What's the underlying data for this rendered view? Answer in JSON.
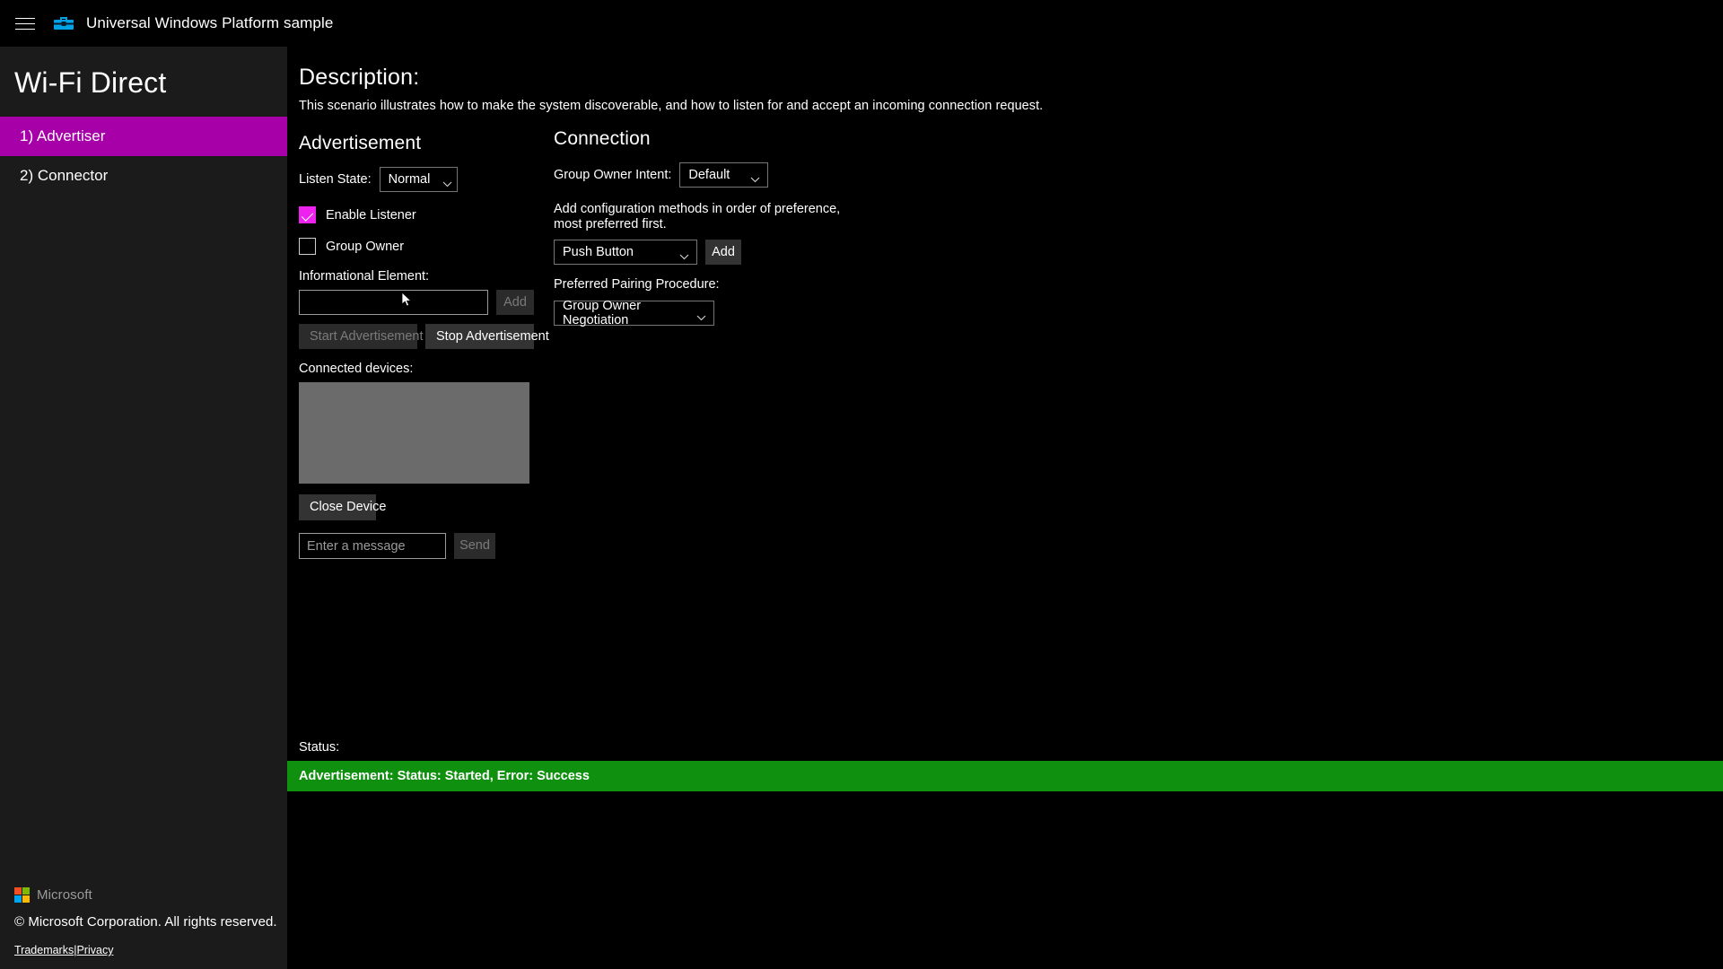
{
  "titlebar": {
    "menu_icon": "hamburger-menu-icon",
    "app_icon": "toolbox-app-icon",
    "title": "Universal Windows Platform sample"
  },
  "sidebar": {
    "header": "Wi-Fi Direct",
    "items": [
      {
        "label": "1) Advertiser",
        "selected": true
      },
      {
        "label": "2) Connector",
        "selected": false
      }
    ],
    "footer": {
      "brand": "Microsoft",
      "copyright": "© Microsoft Corporation. All rights reserved.",
      "link_trademarks": "Trademarks",
      "link_separator": "|",
      "link_privacy": "Privacy"
    }
  },
  "description": {
    "title": "Description:",
    "text": "This scenario illustrates how to make the system discoverable, and how to listen for and accept an incoming connection request."
  },
  "advertisement": {
    "section_title": "Advertisement",
    "listen_state_label": "Listen State:",
    "listen_state_value": "Normal",
    "enable_listener_label": "Enable Listener",
    "enable_listener_checked": true,
    "group_owner_label": "Group Owner",
    "group_owner_checked": false,
    "informational_element_label": "Informational Element:",
    "informational_element_value": "",
    "informational_element_placeholder": "",
    "add_ie_label": "Add",
    "start_label": "Start Advertisement",
    "stop_label": "Stop Advertisement",
    "connected_devices_label": "Connected devices:",
    "close_device_label": "Close Device",
    "message_placeholder": "Enter a message",
    "message_value": "",
    "send_label": "Send"
  },
  "connection": {
    "section_title": "Connection",
    "group_owner_intent_label": "Group Owner Intent:",
    "group_owner_intent_value": "Default",
    "config_methods_line1": "Add configuration methods in order of preference,",
    "config_methods_line2": "most preferred first.",
    "config_method_value": "Push Button",
    "add_config_label": "Add",
    "pairing_label": "Preferred Pairing Procedure:",
    "pairing_value": "Group Owner Negotiation"
  },
  "status": {
    "label": "Status:",
    "message": "Advertisement: Status: Started, Error: Success",
    "color": "#10900f"
  },
  "colors": {
    "accent": "#a800a8",
    "checkbox_accent": "#ee22ee",
    "status_success": "#10900f",
    "sidebar_bg": "#1b1b1b",
    "page_bg": "#000000"
  }
}
